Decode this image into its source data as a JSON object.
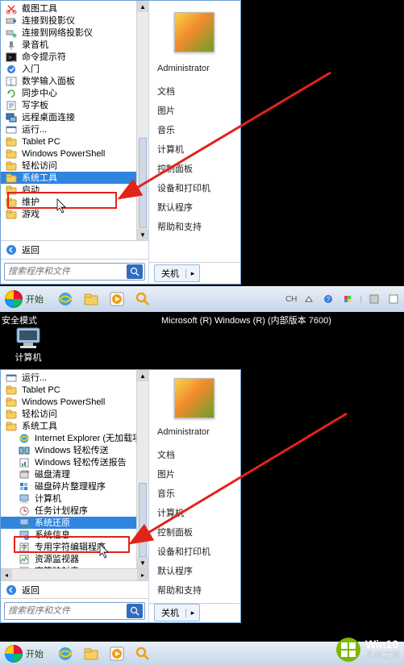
{
  "top_menu": {
    "programs": [
      {
        "icon": "snip",
        "label": "截图工具"
      },
      {
        "icon": "proj",
        "label": "连接到投影仪"
      },
      {
        "icon": "netproj",
        "label": "连接到网络投影仪"
      },
      {
        "icon": "rec",
        "label": "录音机"
      },
      {
        "icon": "cmd",
        "label": "命令提示符"
      },
      {
        "icon": "start",
        "label": "入门"
      },
      {
        "icon": "math",
        "label": "数学输入面板"
      },
      {
        "icon": "sync",
        "label": "同步中心"
      },
      {
        "icon": "wordpad",
        "label": "写字板"
      },
      {
        "icon": "rdp",
        "label": "远程桌面连接"
      },
      {
        "icon": "run",
        "label": "运行..."
      },
      {
        "icon": "folder",
        "label": "Tablet PC"
      },
      {
        "icon": "folder",
        "label": "Windows PowerShell"
      },
      {
        "icon": "folder",
        "label": "轻松访问"
      },
      {
        "icon": "folder",
        "label": "系统工具",
        "selected": true
      },
      {
        "icon": "folder",
        "label": "启动"
      },
      {
        "icon": "folder",
        "label": "维护"
      },
      {
        "icon": "folder",
        "label": "游戏"
      }
    ],
    "back": "返回",
    "search_placeholder": "搜索程序和文件",
    "account": "Administrator",
    "right_links": [
      "文档",
      "图片",
      "音乐",
      "计算机",
      "控制面板",
      "设备和打印机",
      "默认程序",
      "帮助和支持"
    ],
    "shutdown": "关机"
  },
  "bottom_menu": {
    "programs": [
      {
        "icon": "run",
        "label": "运行..."
      },
      {
        "icon": "folder",
        "label": "Tablet PC"
      },
      {
        "icon": "folder",
        "label": "Windows PowerShell"
      },
      {
        "icon": "folder",
        "label": "轻松访问"
      },
      {
        "icon": "folder",
        "label": "系统工具",
        "expanded": true
      },
      {
        "icon": "ie",
        "label": "Internet Explorer (无加载项)",
        "indent": 1
      },
      {
        "icon": "transfer",
        "label": "Windows 轻松传送",
        "indent": 1
      },
      {
        "icon": "report",
        "label": "Windows 轻松传送报告",
        "indent": 1
      },
      {
        "icon": "cleanup",
        "label": "磁盘清理",
        "indent": 1
      },
      {
        "icon": "defrag",
        "label": "磁盘碎片整理程序",
        "indent": 1
      },
      {
        "icon": "computer",
        "label": "计算机",
        "indent": 1
      },
      {
        "icon": "tasksched",
        "label": "任务计划程序",
        "indent": 1
      },
      {
        "icon": "restore",
        "label": "系统还原",
        "indent": 1,
        "selected": true
      },
      {
        "icon": "sysinfo",
        "label": "系统信息",
        "indent": 1
      },
      {
        "icon": "charmap",
        "label": "专用字符编辑程序",
        "indent": 1
      },
      {
        "icon": "resmon",
        "label": "资源监视器",
        "indent": 1
      },
      {
        "icon": "charmap2",
        "label": "字符映射表",
        "indent": 1
      }
    ],
    "back": "返回",
    "search_placeholder": "搜索程序和文件",
    "account": "Administrator",
    "right_links": [
      "文档",
      "图片",
      "音乐",
      "计算机",
      "控制面板",
      "设备和打印机",
      "默认程序",
      "帮助和支持"
    ],
    "shutdown": "关机"
  },
  "taskbar": {
    "start": "开始",
    "lang": "CH"
  },
  "safe_mode": {
    "corner": "安全模式",
    "center": "Microsoft (R) Windows (R) (内部版本 7600)",
    "computer": "计算机"
  },
  "watermark": {
    "line1": "Win10",
    "line2": "系统之家"
  },
  "colors": {
    "select_blue": "#2f85e0",
    "red": "#e2231a"
  }
}
